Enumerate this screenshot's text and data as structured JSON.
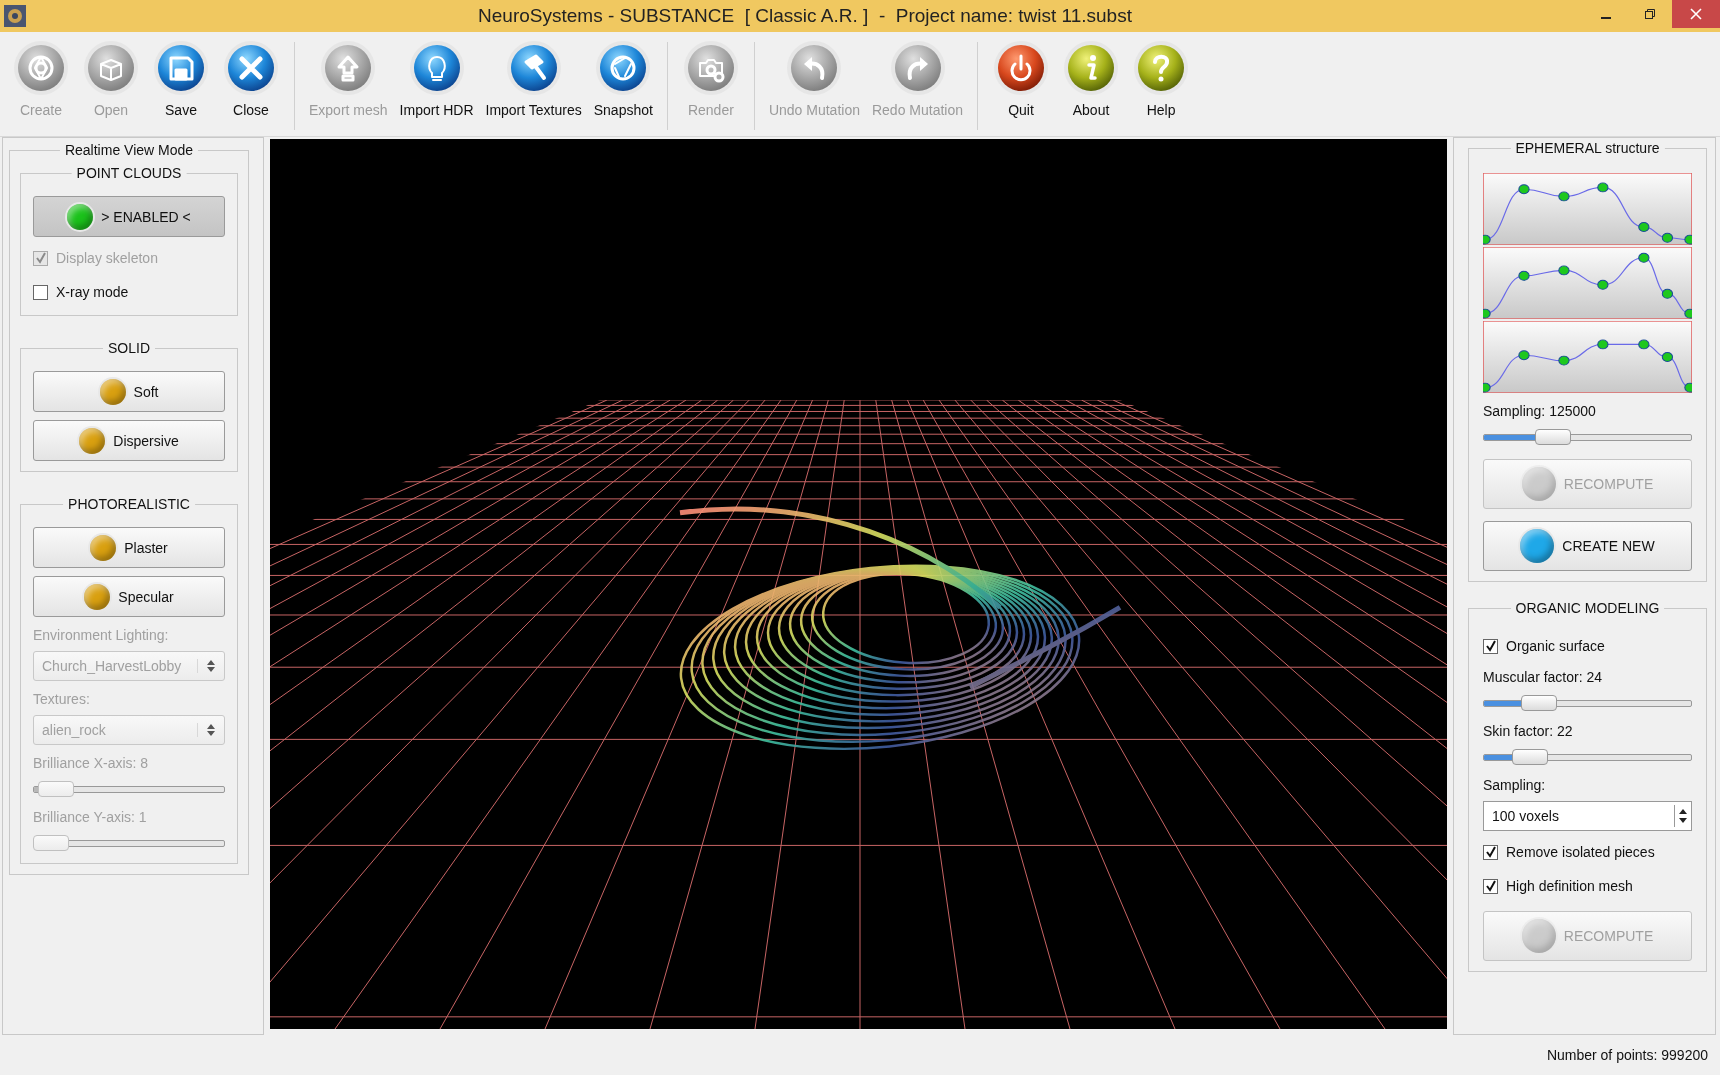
{
  "window": {
    "title": "NeuroSystems - SUBSTANCE  [ Classic A.R. ]  -  Project name: twist 11.subst"
  },
  "toolbar_groups": [
    {
      "buttons": [
        {
          "label": "Create",
          "disabled": true
        },
        {
          "label": "Open",
          "disabled": true
        },
        {
          "label": "Save",
          "disabled": false
        },
        {
          "label": "Close",
          "disabled": false
        }
      ]
    },
    {
      "buttons": [
        {
          "label": "Export mesh",
          "disabled": true
        },
        {
          "label": "Import HDR",
          "disabled": false
        },
        {
          "label": "Import Textures",
          "disabled": false
        },
        {
          "label": "Snapshot",
          "disabled": false
        }
      ]
    },
    {
      "buttons": [
        {
          "label": "Render",
          "disabled": true
        }
      ]
    },
    {
      "buttons": [
        {
          "label": "Undo Mutation",
          "disabled": true
        },
        {
          "label": "Redo Mutation",
          "disabled": true
        }
      ]
    },
    {
      "buttons": [
        {
          "label": "Quit",
          "disabled": false
        },
        {
          "label": "About",
          "disabled": false
        },
        {
          "label": "Help",
          "disabled": false
        }
      ]
    }
  ],
  "left_panel": {
    "title": "Realtime View Mode",
    "sections": [
      {
        "title": "POINT CLOUDS",
        "items": [
          {
            "kind": "button",
            "label": "> ENABLED <",
            "color": "#1bc21b",
            "pressed": true,
            "disabled": false
          },
          {
            "kind": "checkbox",
            "label": "Display skeleton",
            "checked": true,
            "disabled": true
          },
          {
            "kind": "checkbox",
            "label": "X-ray mode",
            "checked": false,
            "disabled": false
          }
        ]
      },
      {
        "title": "SOLID",
        "items": [
          {
            "kind": "button",
            "label": "Soft",
            "color": "#d9a010",
            "pressed": false,
            "disabled": false
          },
          {
            "kind": "button",
            "label": "Dispersive",
            "color": "#d9a010",
            "pressed": false,
            "disabled": false
          }
        ]
      },
      {
        "title": "PHOTOREALISTIC",
        "items": [
          {
            "kind": "button",
            "label": "Plaster",
            "color": "#d9a010",
            "pressed": false,
            "disabled": false
          },
          {
            "kind": "button",
            "label": "Specular",
            "color": "#d9a010",
            "pressed": false,
            "disabled": false
          },
          {
            "kind": "label",
            "label": "Environment Lighting:",
            "disabled": true
          },
          {
            "kind": "combo",
            "value": "Church_HarvestLobby",
            "disabled": true
          },
          {
            "kind": "label",
            "label": "Textures:",
            "disabled": true
          },
          {
            "kind": "combo",
            "value": "alien_rock",
            "disabled": true
          },
          {
            "kind": "label",
            "label": "Brilliance X-axis: 8",
            "disabled": true
          },
          {
            "kind": "slider",
            "level": 0.03,
            "disabled": true
          },
          {
            "kind": "label",
            "label": "Brilliance Y-axis: 1",
            "disabled": true
          },
          {
            "kind": "slider",
            "level": 0.0,
            "disabled": true
          }
        ]
      }
    ]
  },
  "right_panel": {
    "sections": [
      {
        "title": "EPHEMERAL structure",
        "items": [
          {
            "kind": "curves"
          },
          {
            "kind": "label",
            "label": "Sampling: 125000",
            "disabled": false
          },
          {
            "kind": "slider",
            "level": 0.3,
            "disabled": false
          },
          {
            "kind": "button",
            "label": "RECOMPUTE",
            "color": "#b4b4b4",
            "pressed": false,
            "disabled": true
          },
          {
            "kind": "button",
            "label": "CREATE NEW",
            "color": "#1fa8e8",
            "pressed": false,
            "disabled": false
          }
        ]
      },
      {
        "title": "ORGANIC MODELING",
        "items": [
          {
            "kind": "checkbox",
            "label": "Organic surface",
            "checked": true,
            "disabled": false
          },
          {
            "kind": "label",
            "label": "Muscular factor: 24",
            "disabled": false
          },
          {
            "kind": "slider",
            "level": 0.22,
            "disabled": false
          },
          {
            "kind": "label",
            "label": "Skin factor: 22",
            "disabled": false
          },
          {
            "kind": "slider",
            "level": 0.17,
            "disabled": false
          },
          {
            "kind": "label",
            "label": "Sampling:",
            "disabled": false
          },
          {
            "kind": "spin",
            "value": "100 voxels",
            "disabled": false
          },
          {
            "kind": "checkbox",
            "label": "Remove isolated pieces",
            "checked": true,
            "disabled": false
          },
          {
            "kind": "checkbox",
            "label": "High definition mesh",
            "checked": true,
            "disabled": false
          },
          {
            "kind": "button",
            "label": "RECOMPUTE",
            "color": "#b4b4b4",
            "pressed": false,
            "disabled": true
          }
        ]
      }
    ]
  },
  "status_bar": {
    "text": "Number of points: 999200"
  }
}
